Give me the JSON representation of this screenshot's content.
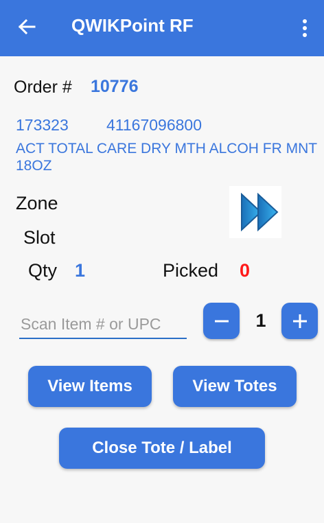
{
  "header": {
    "title": "QWIKPoint RF",
    "back_icon": "arrow-left-icon",
    "menu_icon": "more-vert-icon"
  },
  "order": {
    "label": "Order #",
    "number": "10776"
  },
  "item": {
    "id": "173323",
    "upc": "41167096800",
    "description": "ACT TOTAL CARE DRY MTH ALCOH FR MNT 18OZ"
  },
  "location": {
    "zone_label": "Zone",
    "slot_label": "Slot"
  },
  "counts": {
    "qty_label": "Qty",
    "qty_value": "1",
    "picked_label": "Picked",
    "picked_value": "0"
  },
  "scan": {
    "placeholder": "Scan Item # or UPC"
  },
  "stepper": {
    "value": "1"
  },
  "buttons": {
    "view_items": "View Items",
    "view_totes": "View Totes",
    "close_tote": "Close Tote / Label"
  },
  "colors": {
    "primary": "#3a76dd",
    "alert": "#ff1a1a",
    "background": "#f7f7f7"
  }
}
